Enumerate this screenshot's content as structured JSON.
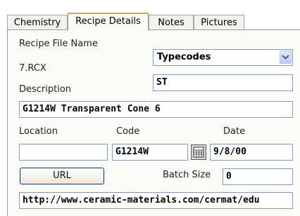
{
  "tabs": [
    {
      "label": "Chemistry",
      "active": false
    },
    {
      "label": "Recipe Details",
      "active": true
    },
    {
      "label": "Notes",
      "active": false
    },
    {
      "label": "Pictures",
      "active": false
    }
  ],
  "recipe": {
    "file_name_label": "Recipe File Name",
    "file_name_value": "7.RCX",
    "typecodes_select": "Typecodes",
    "typecode_value": "ST",
    "description_label": "Description",
    "description_value": "G1214W Transparent Cone 6",
    "location_label": "Location",
    "location_value": "",
    "code_label": "Code",
    "code_value": "G1214W",
    "date_label": "Date",
    "date_value": "9/8/00",
    "url_button": "URL",
    "batch_size_label": "Batch Size",
    "batch_size_value": "0",
    "url_value": "http://www.ceramic-materials.com/cermat/edu"
  },
  "colors": {
    "active_tab_accent": "#e5a23a",
    "field_border": "#7f9db9",
    "panel_bg": "#fbfbf8"
  },
  "icons": {
    "calendar": "calendar-icon",
    "dropdown": "chevron-down-icon"
  }
}
